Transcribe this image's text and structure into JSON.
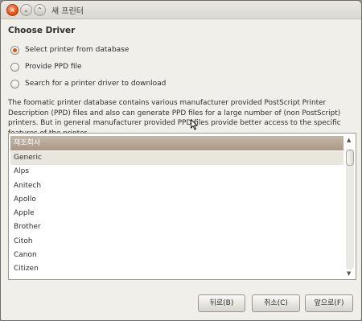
{
  "window": {
    "title": "새 프린터"
  },
  "heading": "Choose Driver",
  "options": [
    {
      "label": "Select printer from database",
      "checked": true
    },
    {
      "label": "Provide PPD file",
      "checked": false
    },
    {
      "label": "Search for a printer driver to download",
      "checked": false
    }
  ],
  "description": "The foomatic printer database contains various manufacturer provided PostScript Printer Description (PPD) files and also can generate PPD files for a large number of (non PostScript) printers. But in general manufacturer provided PPD files provide better access to the specific features of the printer.",
  "list": {
    "header": "제조회사",
    "items": [
      "Generic",
      "Alps",
      "Anitech",
      "Apollo",
      "Apple",
      "Brother",
      "Citoh",
      "Canon",
      "Citizen"
    ],
    "selected_index": 0
  },
  "buttons": {
    "back": "뒤로(B)",
    "cancel": "취소(C)",
    "forward": "앞으로(F)"
  },
  "colors": {
    "accent": "#d9561b",
    "header_bg": "#b3a390"
  },
  "icons": {
    "close": "close-icon",
    "minimize": "minimize-icon",
    "maximize": "maximize-icon"
  }
}
